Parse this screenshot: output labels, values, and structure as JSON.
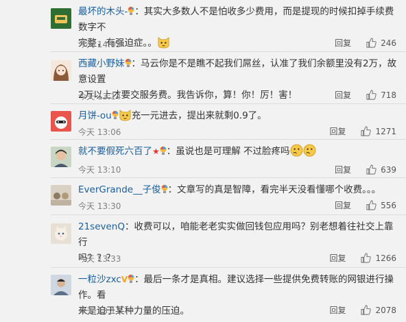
{
  "comments": [
    {
      "user": "最坏的木头-",
      "text_lines": [
        "：其实大多数人不是怕收多少费用，而是提现的时候扣掉手续费数字不",
        "完整，有强迫症。。"
      ],
      "time": "今天 14:03",
      "reply": "回复",
      "likes": "246"
    },
    {
      "user": "西藏小野妹",
      "text_lines": [
        "：马云你是不是瞧不起我们屌丝，认准了我们余额里没有2万，故意设置",
        "2万以上才要交服务费。我告诉你，算！你！厉！害！"
      ],
      "time": "今天 13:14",
      "reply": "回复",
      "likes": "718"
    },
    {
      "user": "月饼-ou",
      "text_lines": [
        "充一元进去，提出来就剩0.9了。"
      ],
      "time": "今天 13:06",
      "reply": "回复",
      "likes": "1271"
    },
    {
      "user": "就不要假死六百了",
      "text_lines": [
        "：虽说也是可理解 不过脸疼吗"
      ],
      "time": "今天 13:10",
      "reply": "回复",
      "likes": "639"
    },
    {
      "user": "EverGrande__子俊",
      "text_lines": [
        "：文章写的真是智障，看完半天没看懂哪个收费。。。"
      ],
      "time": "今天 13:30",
      "reply": "回复",
      "likes": "556"
    },
    {
      "user": "21sevenQ",
      "text_lines": [
        "：收费可以，咱能老老实实做回钱包应用吗？别老想着往社交上靠行",
        "吗？？？"
      ],
      "time": "今天 13:33",
      "reply": "回复",
      "likes": "1266"
    },
    {
      "user": "一粒沙zxc",
      "text_lines": [
        "：最后一条才是真相。建议选择一些提供免费转账的网银进行操作。看",
        "来是迫于某种力量的压迫。"
      ],
      "time": "今天 13:11",
      "reply": "回复",
      "likes": "2078"
    }
  ],
  "colors": {
    "username": "#1a5e9e",
    "text": "#333333",
    "meta": "#808080"
  },
  "icons": {
    "like": "thumbs-up-icon",
    "badge": "colorful-bulb-badge-icon",
    "emoji": "cat-emoji-icon"
  }
}
